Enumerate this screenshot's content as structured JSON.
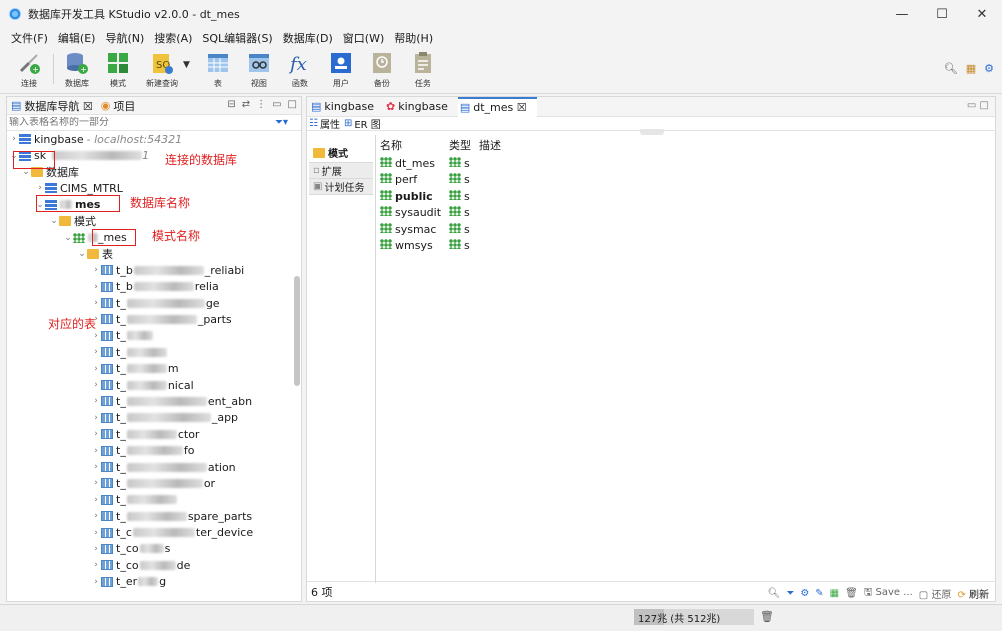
{
  "window": {
    "title": "数据库开发工具 KStudio v2.0.0 - dt_mes",
    "controls": [
      "—",
      "☐",
      "✕"
    ]
  },
  "menu": [
    "文件(F)",
    "编辑(E)",
    "导航(N)",
    "搜索(A)",
    "SQL编辑器(S)",
    "数据库(D)",
    "窗口(W)",
    "帮助(H)"
  ],
  "toolbar": {
    "items": [
      {
        "label": "连接",
        "icon": "connect-icon"
      },
      {
        "label": "数据库",
        "icon": "database-add-icon"
      },
      {
        "label": "模式",
        "icon": "schema-icon"
      },
      {
        "label": "新建查询",
        "icon": "new-query-icon"
      },
      {
        "label": "表",
        "icon": "table-icon"
      },
      {
        "label": "视图",
        "icon": "view-icon"
      },
      {
        "label": "函数",
        "icon": "function-icon"
      },
      {
        "label": "用户",
        "icon": "user-icon"
      },
      {
        "label": "备份",
        "icon": "backup-icon"
      },
      {
        "label": "任务",
        "icon": "task-icon"
      }
    ]
  },
  "navigator": {
    "tabs": [
      "数据库导航 ☒",
      "项目"
    ],
    "filter_placeholder": "输入表格名称的一部分",
    "kingbase_label": "kingbase",
    "kingbase_host": "- localhost:54321",
    "sk_label": "sk",
    "sk_host_suffix": "1",
    "databases_folder": "数据库",
    "cims_label": "CIMS_MTRL",
    "mes_label": "mes",
    "schemas_folder": "模式",
    "schema_label_suffix": "_mes",
    "tables_folder": "表",
    "tables": [
      {
        "prefix": "t_b",
        "suffix": "_reliabi"
      },
      {
        "prefix": "t_b",
        "suffix": "relia"
      },
      {
        "prefix": "t_",
        "suffix": "ge"
      },
      {
        "prefix": "t_",
        "suffix": "_parts"
      },
      {
        "prefix": "t_",
        "suffix": ""
      },
      {
        "prefix": "t_",
        "suffix": ""
      },
      {
        "prefix": "t_",
        "suffix": "m"
      },
      {
        "prefix": "t_",
        "suffix": "nical"
      },
      {
        "prefix": "t_",
        "suffix": "ent_abn"
      },
      {
        "prefix": "t_",
        "suffix": "_app"
      },
      {
        "prefix": "t_",
        "suffix": "ctor"
      },
      {
        "prefix": "t_",
        "suffix": "fo"
      },
      {
        "prefix": "t_",
        "suffix": "ation"
      },
      {
        "prefix": "t_",
        "suffix": "or"
      },
      {
        "prefix": "t_",
        "suffix": ""
      },
      {
        "prefix": "t_",
        "suffix": "spare_parts"
      },
      {
        "prefix": "t_c",
        "suffix": "ter_device"
      },
      {
        "prefix": "t_co",
        "suffix": "s"
      },
      {
        "prefix": "t_co",
        "suffix": "de"
      },
      {
        "prefix": "t_er",
        "suffix": "g"
      },
      {
        "prefix": "t_",
        "suffix": ""
      }
    ]
  },
  "annotations": {
    "connected_db": "连接的数据库",
    "db_name": "数据库名称",
    "schema_name": "模式名称",
    "tables": "对应的表"
  },
  "editor": {
    "tabs": [
      {
        "label": "kingbase",
        "icon": "database-icon"
      },
      {
        "label": "kingbase",
        "icon": "kingbase-icon"
      },
      {
        "label": "dt_mes ☒",
        "icon": "schema-db-icon"
      }
    ],
    "subtabs": [
      "属性",
      "ER 图"
    ],
    "side_tabs": [
      "模式",
      "扩展",
      "计划任务"
    ],
    "columns": [
      "名称",
      "类型",
      "描述"
    ],
    "rows": [
      {
        "name": "dt_mes",
        "type": "s",
        "bold": false
      },
      {
        "name": "perf",
        "type": "s",
        "bold": false
      },
      {
        "name": "public",
        "type": "s",
        "bold": true
      },
      {
        "name": "sysaudit",
        "type": "s",
        "bold": false
      },
      {
        "name": "sysmac",
        "type": "s",
        "bold": false
      },
      {
        "name": "wmsys",
        "type": "s",
        "bold": false
      }
    ],
    "count": "6 项",
    "save_label": "Save ...",
    "revert_label": "还原",
    "refresh_label": "刷新"
  },
  "statusbar": {
    "heap": "127兆 (共 512兆)",
    "heap_fraction": 0.25
  }
}
